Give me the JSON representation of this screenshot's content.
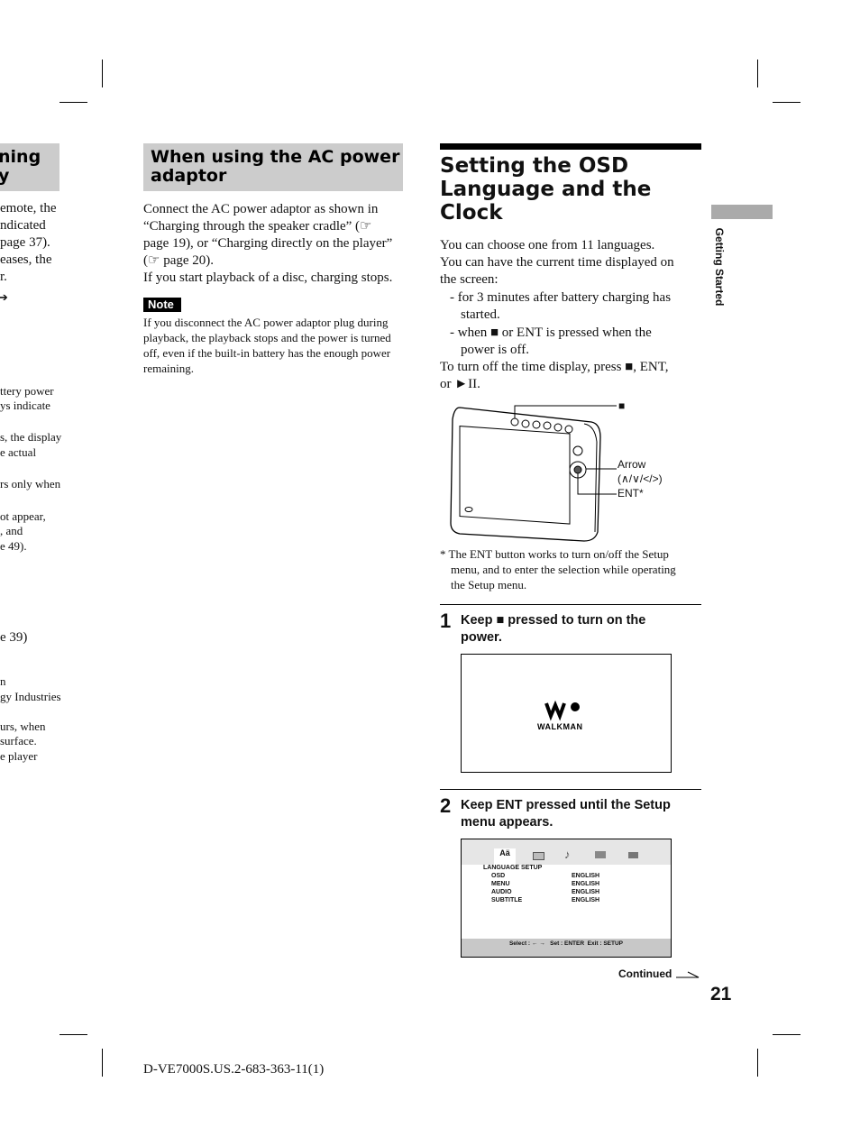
{
  "left_column": {
    "heading": [
      "ning",
      "y"
    ],
    "lines": [
      "emote, the",
      "ndicated",
      "page 37).",
      "eases, the",
      "r."
    ],
    "arrow": "➔",
    "small_lines": [
      "ttery power",
      "ys indicate",
      "s, the display",
      "e actual",
      "rs only when",
      "ot appear,",
      ", and",
      "e 49)."
    ],
    "line_page39": "e 39)",
    "small_lines2": [
      "n",
      "gy Industries",
      "urs, when",
      "surface.",
      "e player"
    ]
  },
  "ac_adaptor": {
    "heading": "When using the AC power adaptor",
    "body": [
      "Connect the AC power adaptor as shown in",
      "“Charging through the speaker cradle” (☞",
      "page 19), or “Charging directly on the player”",
      "(☞ page 20).",
      "If you start playback of a disc, charging stops."
    ],
    "note_label": "Note",
    "note": [
      "If you disconnect the AC power adaptor plug during",
      "playback, the playback stops and the power is turned",
      "off, even if the built-in battery has the enough power",
      "remaining."
    ]
  },
  "osd": {
    "title": [
      "Setting the OSD",
      "Language and the",
      "Clock"
    ],
    "intro": [
      "You can choose one from 11 languages.",
      "You can have the current time displayed on",
      "the screen:"
    ],
    "bullets": [
      [
        "- for 3 minutes after battery charging has",
        "started."
      ],
      [
        "- when ■ or ENT is pressed when the",
        "power is off."
      ]
    ],
    "turn_off": [
      "To turn off the time display, press ■, ENT,",
      "or ►II."
    ],
    "figure_labels": {
      "stop": "■",
      "arrow": "Arrow",
      "arrow_keys": "(∧/∨/</>)",
      "ent": "ENT*",
      "logo": "WALKMAN"
    },
    "footnote": [
      "* The ENT button works to turn on/off the Setup",
      "menu, and to enter the selection while operating",
      "the Setup menu."
    ],
    "steps": [
      {
        "num": "1",
        "text": [
          "Keep ■ pressed to turn on the",
          "power."
        ]
      },
      {
        "num": "2",
        "text": [
          "Keep ENT pressed until the Setup",
          "menu appears."
        ]
      }
    ],
    "setup_menu": {
      "title": "LANGUAGE SETUP",
      "rows": [
        {
          "label": "OSD",
          "value": "ENGLISH"
        },
        {
          "label": "MENU",
          "value": "ENGLISH"
        },
        {
          "label": "AUDIO",
          "value": "ENGLISH"
        },
        {
          "label": "SUBTITLE",
          "value": "ENGLISH"
        }
      ],
      "footer": "Select : ← →   Set : ENTER  Exit : SETUP",
      "tab_icons": [
        "language-icon",
        "screen-icon",
        "music-note-icon",
        "parental-lock-icon",
        "toolbox-icon"
      ]
    },
    "continued": "Continued"
  },
  "side_tab": "Getting Started",
  "page_number": "21",
  "footer_code": "D-VE7000S.US.2-683-363-11(1)"
}
